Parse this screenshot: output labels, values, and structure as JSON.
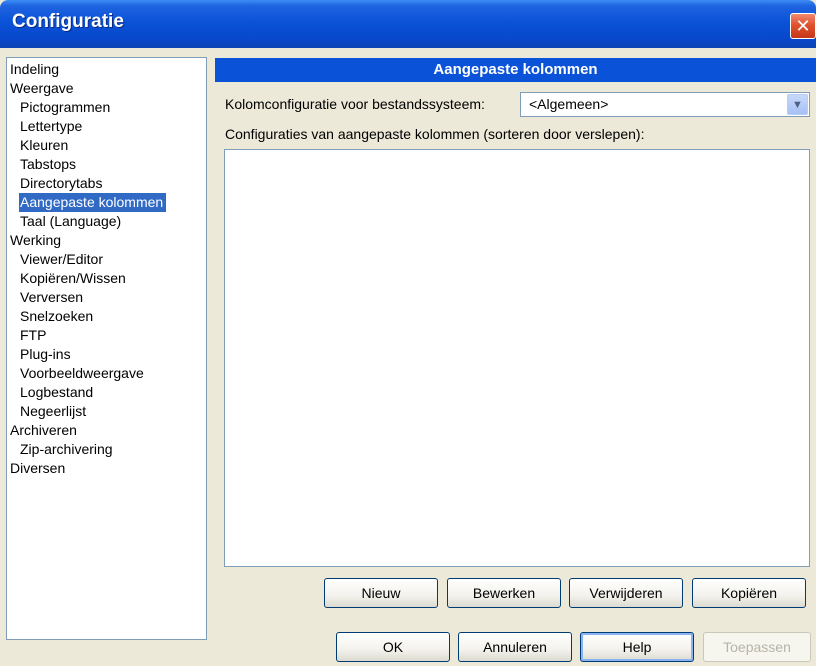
{
  "window": {
    "title": "Configuratie",
    "close_glyph": "✕"
  },
  "nav": {
    "items": [
      {
        "label": "Indeling",
        "child": false,
        "selected": false
      },
      {
        "label": "Weergave",
        "child": false,
        "selected": false
      },
      {
        "label": "Pictogrammen",
        "child": true,
        "selected": false
      },
      {
        "label": "Lettertype",
        "child": true,
        "selected": false
      },
      {
        "label": "Kleuren",
        "child": true,
        "selected": false
      },
      {
        "label": "Tabstops",
        "child": true,
        "selected": false
      },
      {
        "label": "Directorytabs",
        "child": true,
        "selected": false
      },
      {
        "label": "Aangepaste kolommen",
        "child": true,
        "selected": true
      },
      {
        "label": "Taal (Language)",
        "child": true,
        "selected": false
      },
      {
        "label": "Werking",
        "child": false,
        "selected": false
      },
      {
        "label": "Viewer/Editor",
        "child": true,
        "selected": false
      },
      {
        "label": "Kopiëren/Wissen",
        "child": true,
        "selected": false
      },
      {
        "label": "Verversen",
        "child": true,
        "selected": false
      },
      {
        "label": "Snelzoeken",
        "child": true,
        "selected": false
      },
      {
        "label": "FTP",
        "child": true,
        "selected": false
      },
      {
        "label": "Plug-ins",
        "child": true,
        "selected": false
      },
      {
        "label": "Voorbeeldweergave",
        "child": true,
        "selected": false
      },
      {
        "label": "Logbestand",
        "child": true,
        "selected": false
      },
      {
        "label": "Negeerlijst",
        "child": true,
        "selected": false
      },
      {
        "label": "Archiveren",
        "child": false,
        "selected": false
      },
      {
        "label": "Zip-archivering",
        "child": true,
        "selected": false
      },
      {
        "label": "Diversen",
        "child": false,
        "selected": false
      }
    ]
  },
  "panel": {
    "header": "Aangepaste kolommen",
    "fs_label": "Kolomconfiguratie voor bestandssysteem:",
    "fs_value": "<Algemeen>",
    "list_label": "Configuraties van aangepaste kolommen (sorteren door verslepen):",
    "buttons": {
      "new": "Nieuw",
      "edit": "Bewerken",
      "remove": "Verwijderen",
      "copy": "Kopiëren"
    }
  },
  "footer": {
    "ok": "OK",
    "cancel": "Annuleren",
    "help": "Help",
    "apply": "Toepassen"
  },
  "colors": {
    "titlebar": "#0a52d8",
    "selection": "#316ac5",
    "face": "#ece9d8"
  }
}
